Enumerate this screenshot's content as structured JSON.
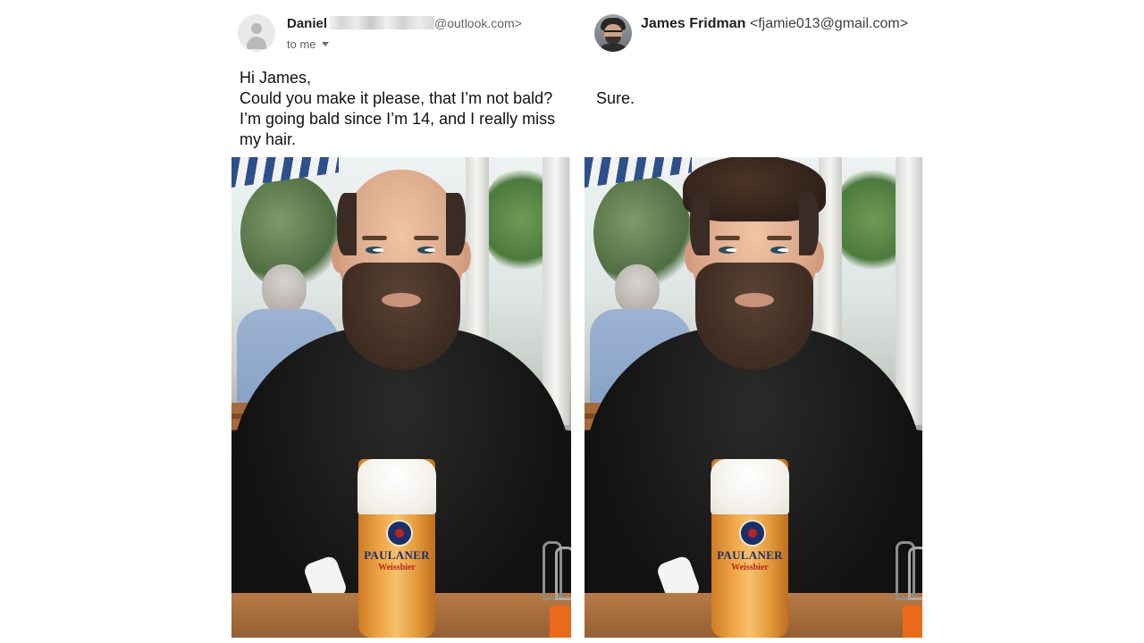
{
  "left_email": {
    "sender_name": "Daniel",
    "sender_email_suffix": "@outlook.com>",
    "recipient": "to me",
    "body_lines": [
      "Hi James,",
      "Could you make it please, that I’m not bald?",
      "I’m going bald since I’m 14, and I really miss",
      "my hair."
    ]
  },
  "right_email": {
    "sender_name": "James Fridman",
    "sender_email": "<fjamie013@gmail.com>",
    "body": "Sure."
  },
  "photos": {
    "glass_brand": "PAULANER",
    "glass_subtext": "Weissbier"
  },
  "icons": {
    "left_avatar": "person-placeholder-icon",
    "right_avatar": "profile-photo",
    "recipient_dropdown": "caret-down-icon"
  }
}
